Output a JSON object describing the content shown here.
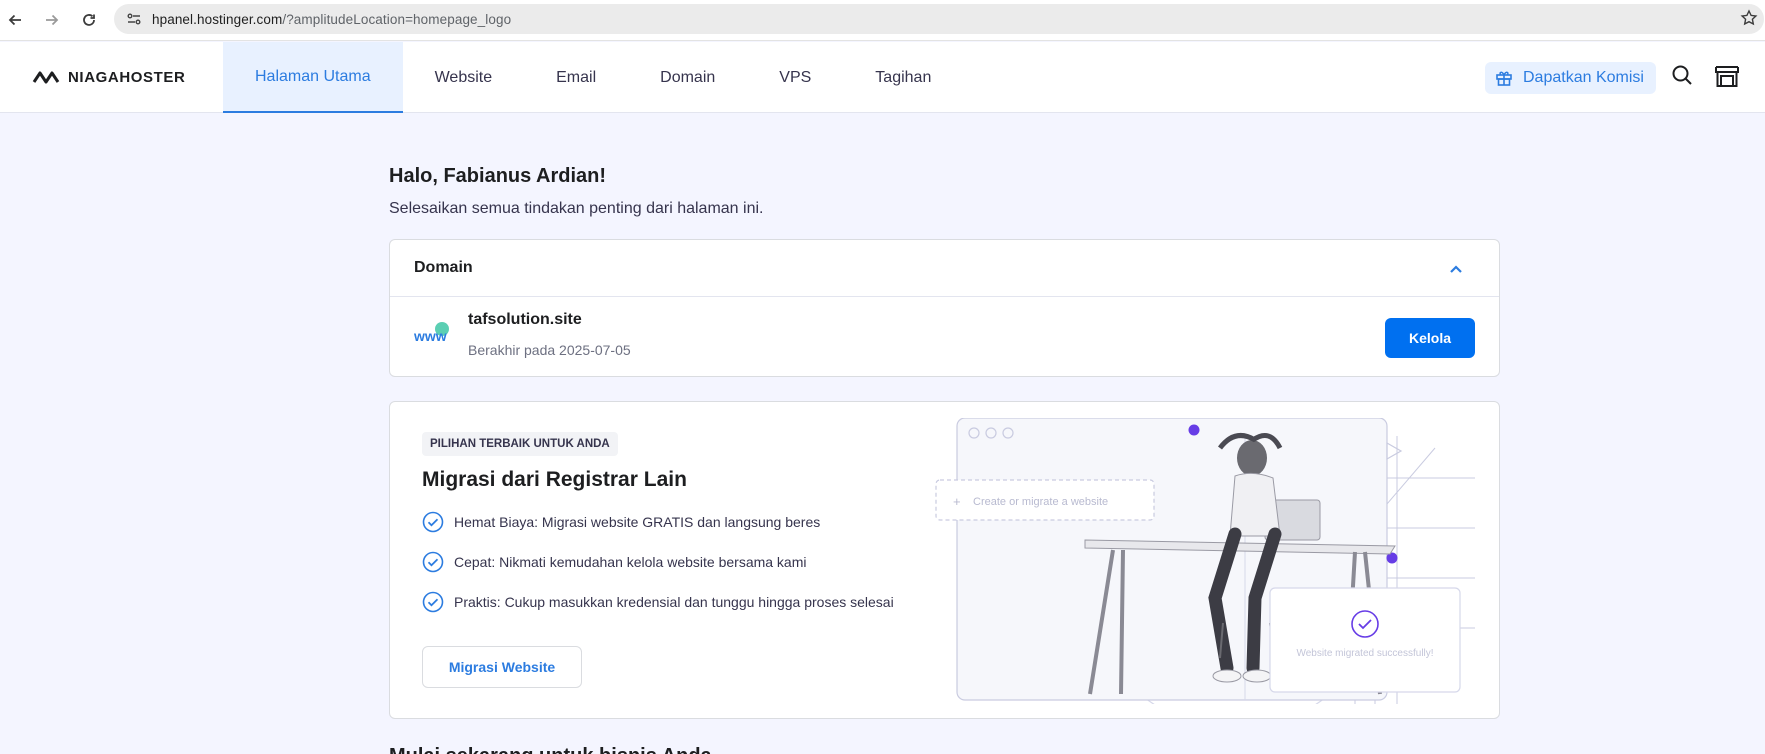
{
  "browser": {
    "url_host": "hpanel.hostinger.com",
    "url_path": "/?amplitudeLocation=homepage_logo"
  },
  "header": {
    "logo_text": "NIAGAHOSTER",
    "nav": [
      {
        "label": "Halaman Utama",
        "active": true
      },
      {
        "label": "Website"
      },
      {
        "label": "Email"
      },
      {
        "label": "Domain"
      },
      {
        "label": "VPS"
      },
      {
        "label": "Tagihan"
      }
    ],
    "referral_label": "Dapatkan Komisi",
    "accent_color": "#2c7ce0"
  },
  "main": {
    "greeting": "Halo, Fabianus Ardian!",
    "subtitle": "Selesaikan semua tindakan penting dari halaman ini.",
    "domain_card": {
      "title": "Domain",
      "domain_name": "tafsolution.site",
      "expiry": "Berakhir pada 2025-07-05",
      "manage_label": "Kelola",
      "icon_text": "www"
    },
    "promo_card": {
      "badge": "PILIHAN TERBAIK UNTUK ANDA",
      "title": "Migrasi dari Registrar Lain",
      "features": [
        "Hemat Biaya: Migrasi website GRATIS dan langsung beres",
        "Cepat: Nikmati kemudahan kelola website bersama kami",
        "Praktis: Cukup masukkan kredensial dan tunggu hingga proses selesai"
      ],
      "cta_label": "Migrasi Website",
      "illustration": {
        "create_label": "Create or migrate a website",
        "success_label": "Website migrated successfully!"
      }
    },
    "next_section_title": "Mulai sekarang untuk bisnis Anda"
  }
}
